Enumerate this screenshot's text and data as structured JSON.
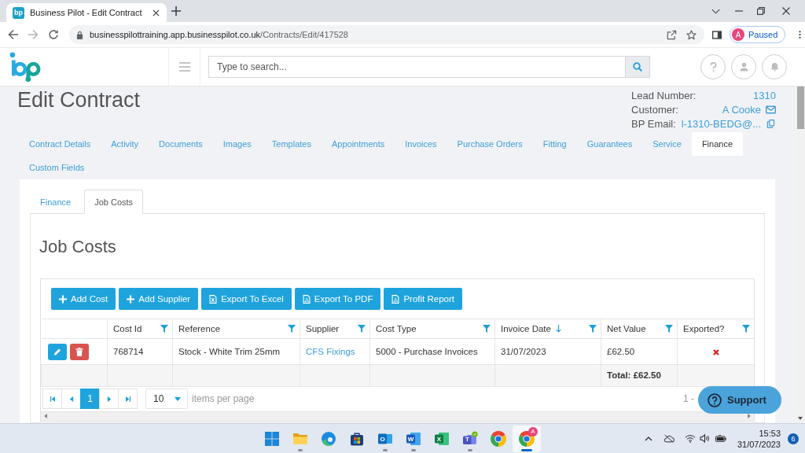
{
  "browser": {
    "tab": {
      "favicon": "bp",
      "title": "Business Pilot - Edit Contract"
    },
    "address": {
      "host": "businesspilottraining.app.businesspilot.co.uk",
      "path": "/Contracts/Edit/417528"
    },
    "profile": {
      "initial": "A",
      "status": "Paused"
    }
  },
  "header": {
    "search": {
      "placeholder": "Type to search..."
    }
  },
  "contract": {
    "title": "Edit Contract",
    "info": [
      {
        "label": "Lead Number:",
        "value": "1310",
        "kind": "plain"
      },
      {
        "label": "Customer:",
        "value": "A Cooke",
        "kind": "email"
      },
      {
        "label": "BP Email:",
        "value": "l-1310-BEDG@...",
        "kind": "copy"
      }
    ]
  },
  "tabs": [
    {
      "label": "Contract Details",
      "selected": false
    },
    {
      "label": "Activity",
      "selected": false
    },
    {
      "label": "Documents",
      "selected": false
    },
    {
      "label": "Images",
      "selected": false
    },
    {
      "label": "Templates",
      "selected": false
    },
    {
      "label": "Appointments",
      "selected": false
    },
    {
      "label": "Invoices",
      "selected": false
    },
    {
      "label": "Purchase Orders",
      "selected": false
    },
    {
      "label": "Fitting",
      "selected": false
    },
    {
      "label": "Guarantees",
      "selected": false
    },
    {
      "label": "Service",
      "selected": false
    },
    {
      "label": "Finance",
      "selected": true
    },
    {
      "label": "Custom Fields",
      "selected": false
    }
  ],
  "subtabs": [
    {
      "label": "Finance",
      "selected": false
    },
    {
      "label": "Job Costs",
      "selected": true
    }
  ],
  "section": {
    "title": "Job Costs"
  },
  "toolbar": [
    {
      "label": "Add Cost",
      "kind": "add"
    },
    {
      "label": "Add Supplier",
      "kind": "add"
    },
    {
      "label": "Export To Excel",
      "kind": "excel"
    },
    {
      "label": "Export To PDF",
      "kind": "pdf"
    },
    {
      "label": "Profit Report",
      "kind": "pdf"
    }
  ],
  "table": {
    "columns": [
      {
        "label": "Cost Id",
        "sorted": false
      },
      {
        "label": "Reference",
        "sorted": false
      },
      {
        "label": "Supplier",
        "sorted": false
      },
      {
        "label": "Cost Type",
        "sorted": false
      },
      {
        "label": "Invoice Date",
        "sorted": true
      },
      {
        "label": "Net Value",
        "sorted": false
      },
      {
        "label": "Exported?",
        "sorted": false
      }
    ],
    "rows": [
      {
        "cost_id": "768714",
        "reference": "Stock - White Trim 25mm",
        "supplier": "CFS Fixings",
        "cost_type": "5000 - Purchase Invoices",
        "invoice_date": "31/07/2023",
        "net_value": "£62.50",
        "exported": false
      }
    ],
    "total": "Total: £62.50"
  },
  "pager": {
    "pages": [
      {
        "label": "1",
        "selected": true
      }
    ],
    "page_size": "10",
    "page_size_label": "items per page",
    "range": "1 -"
  },
  "support": {
    "label": "Support"
  },
  "taskbar": {
    "apps": [
      {
        "kind": "start",
        "running": false,
        "selected": false
      },
      {
        "kind": "explorer",
        "running": true,
        "selected": false
      },
      {
        "kind": "edge",
        "running": false,
        "selected": false
      },
      {
        "kind": "store",
        "running": false,
        "selected": false
      },
      {
        "kind": "outlook",
        "letter": "O",
        "running": true,
        "selected": false
      },
      {
        "kind": "word",
        "letter": "W",
        "running": true,
        "selected": false
      },
      {
        "kind": "excel",
        "letter": "X",
        "running": false,
        "selected": false
      },
      {
        "kind": "teams",
        "letter": "T",
        "running": true,
        "selected": false
      },
      {
        "kind": "chrome",
        "running": false,
        "selected": false
      },
      {
        "kind": "chrome",
        "badge": "A",
        "running": true,
        "selected": true
      }
    ],
    "time": "15:53",
    "date": "31/07/2023",
    "notifications": "6"
  }
}
